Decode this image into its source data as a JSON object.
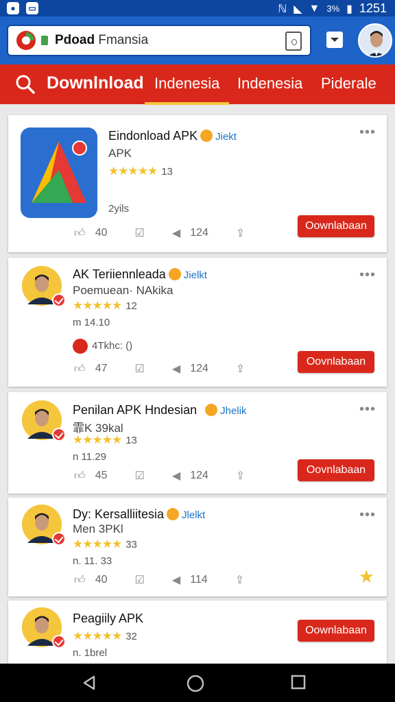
{
  "status_bar": {
    "left_icons": [
      "notification-icon",
      "gallery-icon"
    ],
    "right_icons": [
      "nfc-icon",
      "signal-icon",
      "wifi-icon"
    ],
    "battery_text": "3%",
    "time": "1251"
  },
  "url_bar": {
    "url_bold": "Pdoad",
    "url_rest": " Fmansia"
  },
  "nav": {
    "title": "Downlnload",
    "tabs": [
      "Indenesia",
      "Indenesia",
      "Piderale"
    ],
    "active_tab": 0
  },
  "apps": [
    {
      "title": "Eindonload APK",
      "tag": "Jiekt",
      "subtitle": "APK",
      "stars": "★★★★★",
      "rating_count": "13",
      "meta": "2yils",
      "likes": "40",
      "shares": "124",
      "button": "Oownlabaan"
    },
    {
      "title": "AK Teriiennleada",
      "tag": "Jielkt",
      "subtitle": "Poemuean· NAkika",
      "stars": "★★★★★",
      "rating_count": "12",
      "meta": "m 14.10",
      "dev_text": "4Tkhc: ()",
      "likes": "47",
      "shares": "124",
      "button": "Oovnlabaan"
    },
    {
      "title": "Penilan APK Hndesian",
      "tag": "Jhelik",
      "subtitle": "霏K 39kal",
      "stars": "★★★★★",
      "rating_count": "13",
      "meta": "n 11.29",
      "likes": "45",
      "shares": "124",
      "button": "Oovnlabaan"
    },
    {
      "title": "Dy: Kersalliitesia",
      "tag": "Jlelkt",
      "subtitle": "Men 3PKl",
      "stars": "★★★★★",
      "rating_count": "33",
      "meta": "n. 11. 33",
      "likes": "40",
      "shares": "114"
    },
    {
      "title": "Peagiily APK",
      "stars": "★★★★★",
      "rating_count": "32",
      "meta": "n. 1brel",
      "button": "Oownlabaan"
    }
  ],
  "colors": {
    "status_bar": "#0d47a1",
    "url_bar": "#1e63c7",
    "nav": "#d9281b",
    "tab_indicator": "#f7c53b",
    "button": "#d9281b",
    "star": "#f2c12e"
  },
  "bottom_nav": [
    "back-icon",
    "home-icon",
    "recents-icon"
  ]
}
